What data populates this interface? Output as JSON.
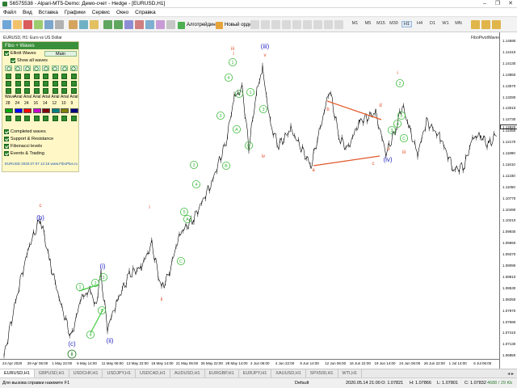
{
  "window": {
    "title": "56575538 - Alpari-MT5-Demo: Демо-счет - Hedge - [EURUSD,H1]",
    "controls": [
      "–",
      "❐",
      "✕"
    ]
  },
  "menu": [
    "Файл",
    "Вид",
    "Вставка",
    "Графики",
    "Сервис",
    "Окно",
    "Справка"
  ],
  "toolbar": {
    "algo_label": "Алготрейдинг",
    "new_order_label": "Новый ордер",
    "timeframes": [
      "M1",
      "M5",
      "M15",
      "M30",
      "H1",
      "H4",
      "D1",
      "W1",
      "MN"
    ],
    "active_timeframe": "H1"
  },
  "chart": {
    "symbol_label": "EURUSD, H1: Euro vs US Dollar",
    "indicator_label": "FiboPivotWaves",
    "price_ticks": [
      "1.14690",
      "1.14410",
      "1.14130",
      "1.13850",
      "1.13570",
      "1.13290",
      "1.13010",
      "1.12730",
      "1.12450",
      "1.12170",
      "1.11890",
      "1.11610",
      "1.11330",
      "1.11050",
      "1.10770",
      "1.10490",
      "1.10210",
      "1.09930",
      "1.09650",
      "1.09370",
      "1.09090",
      "1.08810",
      "1.08530",
      "1.08250",
      "1.07970",
      "1.07690",
      "1.07410",
      "1.07130",
      "1.06850"
    ],
    "current_price": "1.12820",
    "time_ticks": [
      "24 Apr 2020",
      "29 Apr 06:00",
      "1 May 22:00",
      "6 May 14:00",
      "11 May 06:00",
      "13 May 22:00",
      "18 May 14:00",
      "21 May 06:00",
      "25 May 22:00",
      "28 May 14:00",
      "2 Jun 06:00",
      "4 Jun 22:00",
      "9 Jun 14:00",
      "12 Jun 06:00",
      "16 Jun 22:00",
      "19 Jun 14:00",
      "24 Jun 06:00",
      "26 Jun 22:00",
      "1 Jul 14:00",
      "6 Jul 06:00"
    ],
    "wave_labels": {
      "blue": [
        "(b)",
        "(i)",
        "(ii)",
        "(iii)",
        "(iv)"
      ],
      "green": [
        "1",
        "2",
        "3",
        "4",
        "5",
        "A",
        "B",
        "C"
      ],
      "red": [
        "c",
        "i",
        "ii",
        "iii",
        "iv",
        "v",
        "a",
        "b",
        "c",
        "d",
        "e"
      ],
      "special": [
        "(c)",
        "ii"
      ]
    }
  },
  "panel": {
    "title": "Fibo + Waves",
    "elliott_label": "Elliott Waves",
    "mode_label": "Main",
    "show_all_label": "Show all waves",
    "wave_cols": [
      "Wave",
      "Arial",
      "Arial",
      "Arial",
      "Arial",
      "Arial",
      "Arial",
      "Arial"
    ],
    "sizes": [
      "28",
      "24",
      "24",
      "16",
      "14",
      "12",
      "10",
      "9"
    ],
    "completed_label": "Completed waves",
    "support_label": "Support & Resistance",
    "fib_label": "Fibonacci levels",
    "events_label": "Events & Trading",
    "stamp": "EURUSD  2020.07.07 12:15   www.FiboPlus.ru",
    "colors": [
      "#00aa00",
      "#0000ff",
      "#ff0000",
      "#cc00cc",
      "#800000",
      "#008080",
      "#808000",
      "#000080"
    ]
  },
  "tabs": [
    "EURUSD,H1",
    "GBPUSD,H1",
    "USDCHF,H1",
    "USDJPY,H1",
    "USDCAD,H1",
    "AUDUSD,H1",
    "EURGBP,H1",
    "EURJPY,H1",
    "XAUUSD,H1",
    "SPX500,H1",
    "WTI,H1"
  ],
  "active_tab": "EURUSD,H1",
  "status": {
    "help": "Для вызова справки нажмите F1",
    "profile": "Default",
    "datetime": "2020.05.14 21:00",
    "open": "O: 1.07821",
    "high": "H: 1.07866",
    "low": "L: 1.07801",
    "close": "C: 1.07832",
    "traffic": "4688 / 29 Kb"
  }
}
